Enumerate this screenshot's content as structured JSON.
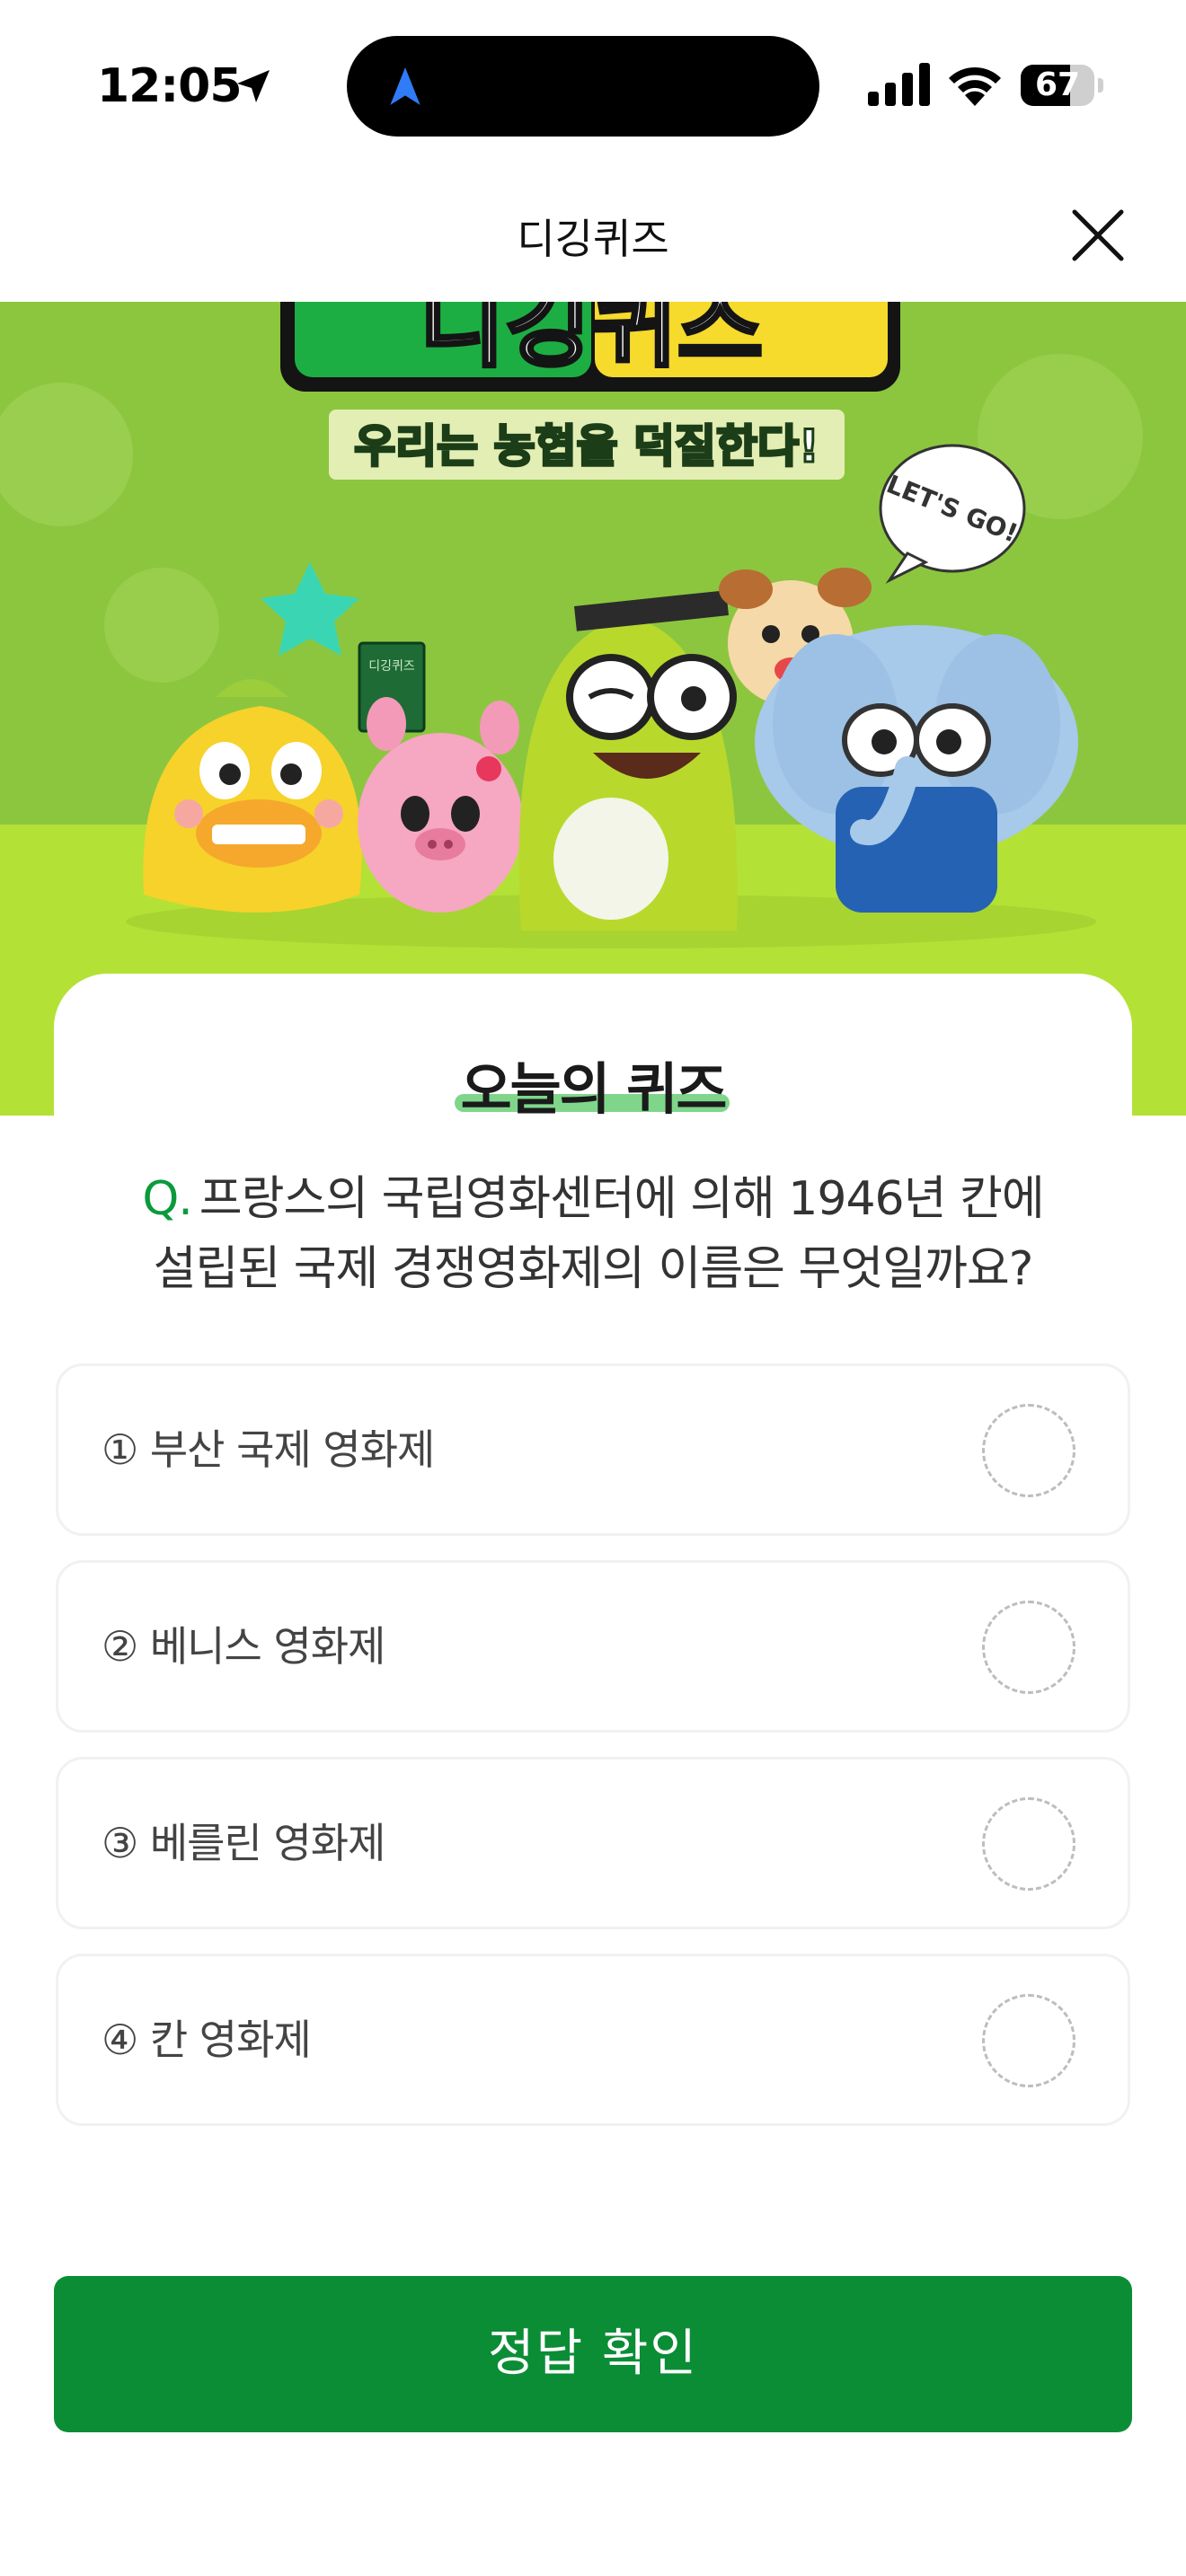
{
  "status_bar": {
    "time": "12:05",
    "battery_level": "67",
    "icons": [
      "location-arrow-icon",
      "navigation-icon",
      "signal-icon",
      "wifi-icon",
      "battery-icon"
    ]
  },
  "header": {
    "title": "디깅퀴즈",
    "close_icon": "close-icon"
  },
  "banner": {
    "logo_text": "디깅퀴즈",
    "slogan": "우리는 농협을 덕질한다!",
    "speech_bubble": "LET'S GO!",
    "book_text": "디깅퀴즈",
    "colors": {
      "sky": "#8cc63f",
      "ground": "#b4e136"
    }
  },
  "quiz": {
    "section_title": "오늘의 퀴즈",
    "question_prefix": "Q.",
    "question_line1": "프랑스의 국립영화센터에 의해 1946년 칸에",
    "question_line2": "설립된 국제 경쟁영화제의 이름은 무엇일까요?",
    "options": [
      {
        "label": "① 부산 국제 영화제"
      },
      {
        "label": "② 베니스 영화제"
      },
      {
        "label": "③ 베를린 영화제"
      },
      {
        "label": "④ 칸 영화제"
      }
    ],
    "selected_option": null
  },
  "submit": {
    "label": "정답 확인"
  },
  "colors": {
    "accent": "#0b8d36",
    "question_mark": "#0a9a3c"
  }
}
